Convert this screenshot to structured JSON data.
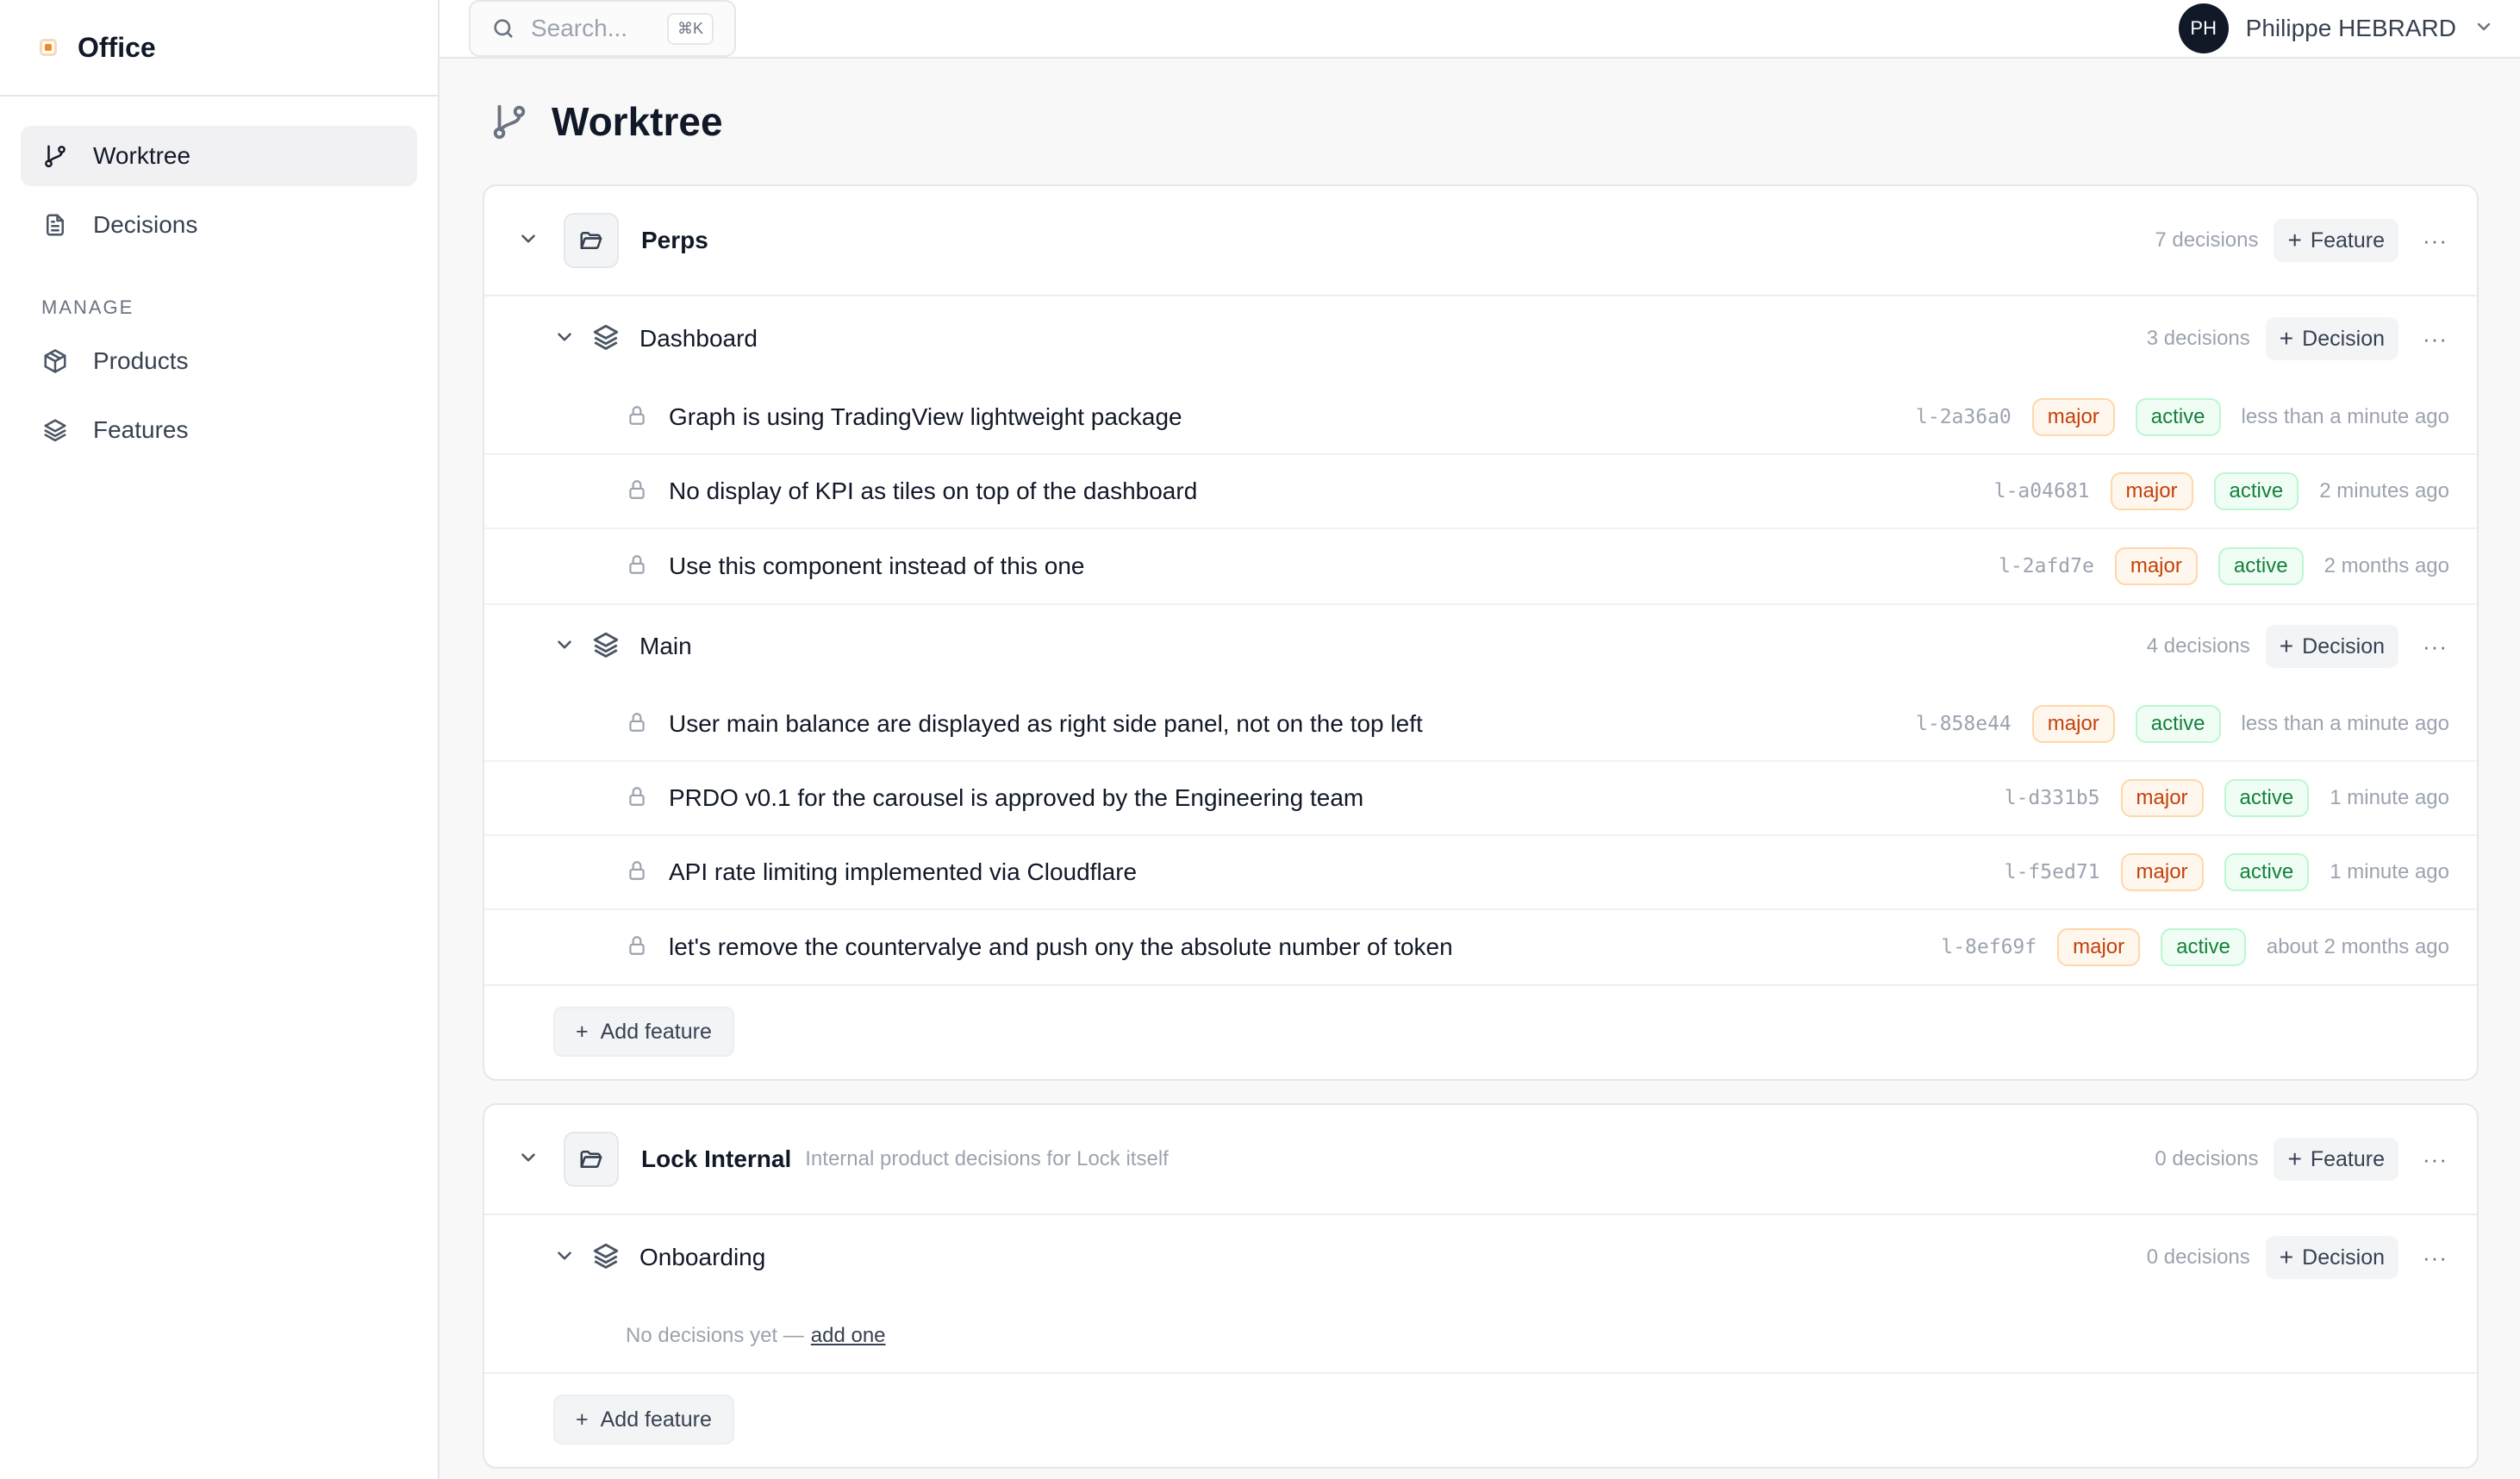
{
  "brand": {
    "name": "Office"
  },
  "sidebar": {
    "items": [
      {
        "label": "Worktree"
      },
      {
        "label": "Decisions"
      }
    ],
    "section_label": "MANAGE",
    "manage_items": [
      {
        "label": "Products"
      },
      {
        "label": "Features"
      }
    ]
  },
  "topbar": {
    "search_placeholder": "Search...",
    "search_shortcut": "⌘K",
    "user_initials": "PH",
    "user_name": "Philippe HEBRARD"
  },
  "page": {
    "title": "Worktree"
  },
  "products": [
    {
      "name": "Perps",
      "description": "",
      "count": "7 decisions",
      "add_label": "Feature",
      "features": [
        {
          "name": "Dashboard",
          "count": "3 decisions",
          "add_label": "Decision",
          "decisions": [
            {
              "title": "Graph is using TradingView lightweight package",
              "hash": "l-2a36a0",
              "impact": "major",
              "status": "active",
              "time": "less than a minute ago"
            },
            {
              "title": "No display of KPI as tiles on top of the dashboard",
              "hash": "l-a04681",
              "impact": "major",
              "status": "active",
              "time": "2 minutes ago"
            },
            {
              "title": "Use this component instead of this one",
              "hash": "l-2afd7e",
              "impact": "major",
              "status": "active",
              "time": "2 months ago"
            }
          ]
        },
        {
          "name": "Main",
          "count": "4 decisions",
          "add_label": "Decision",
          "decisions": [
            {
              "title": "User main balance are displayed as right side panel, not on the top left",
              "hash": "l-858e44",
              "impact": "major",
              "status": "active",
              "time": "less than a minute ago"
            },
            {
              "title": "PRDO v0.1 for the carousel is approved by the Engineering team",
              "hash": "l-d331b5",
              "impact": "major",
              "status": "active",
              "time": "1 minute ago"
            },
            {
              "title": "API rate limiting implemented via Cloudflare",
              "hash": "l-f5ed71",
              "impact": "major",
              "status": "active",
              "time": "1 minute ago"
            },
            {
              "title": "let's remove the countervalye and push ony the absolute number of token",
              "hash": "l-8ef69f",
              "impact": "major",
              "status": "active",
              "time": "about 2 months ago"
            }
          ]
        }
      ],
      "add_feature_label": "Add feature"
    },
    {
      "name": "Lock Internal",
      "description": "Internal product decisions for Lock itself",
      "count": "0 decisions",
      "add_label": "Feature",
      "features": [
        {
          "name": "Onboarding",
          "count": "0 decisions",
          "add_label": "Decision",
          "empty_text": "No decisions yet —",
          "empty_link": "add one"
        }
      ],
      "add_feature_label": "Add feature"
    }
  ],
  "more_glyph": "···",
  "plus_glyph": "+"
}
